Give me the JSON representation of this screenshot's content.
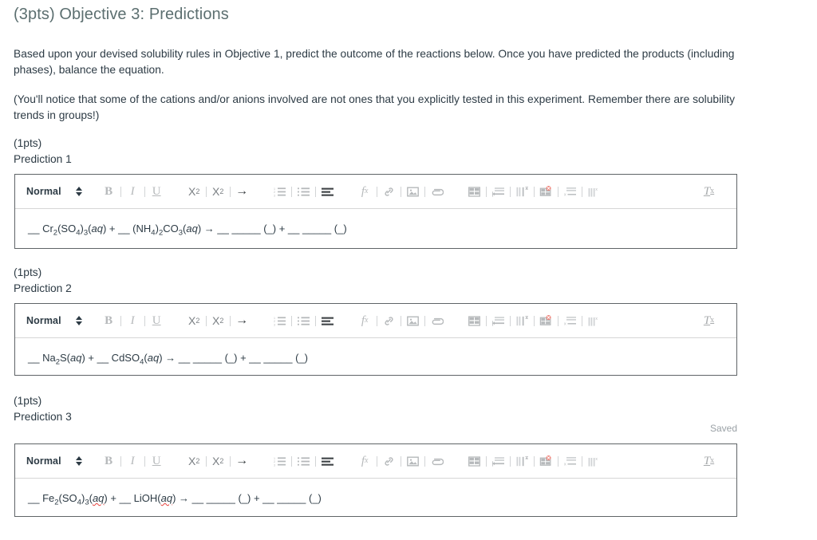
{
  "page": {
    "title": "(3pts) Objective 3: Predictions",
    "title_color": "#5c6f70",
    "paragraph_1": "Based upon your devised solubility rules in Objective 1, predict the outcome of the reactions below. Once you have predicted the products (including phases), balance the equation.",
    "paragraph_2": "(You'll notice that some of the cations and/or anions involved are not ones that you explicitly tested in this experiment. Remember there are solubility trends in groups!)",
    "saved_status": "Saved"
  },
  "toolbar": {
    "format_value": "Normal",
    "format_options": [
      "Normal"
    ],
    "bold_label": "B",
    "italic_label": "I",
    "underline_label": "U",
    "subscript_label": "X",
    "subscript_index": "2",
    "superscript_label": "X",
    "superscript_index": "2",
    "arrow_label": "→",
    "formula_label": "f",
    "formula_index": "x",
    "clear_format_label": "T",
    "clear_format_index": "x",
    "icons": [
      "numbered-list-icon",
      "bulleted-list-icon",
      "align-icon",
      "formula-icon",
      "link-icon",
      "image-icon",
      "attachment-icon",
      "table-icon",
      "table-row-icon",
      "table-column-icon",
      "table-delete-icon",
      "table-cell-icon",
      "table-merge-icon",
      "clear-formatting-icon"
    ],
    "accent_color": "#e8413c"
  },
  "predictions": [
    {
      "points": "(1pts)",
      "name": "Prediction 1",
      "equation_html": "__ Cr<sub>2</sub>(SO<sub>4</sub>)<sub>3</sub>(<i>aq</i>) + __ (NH<sub>4</sub>)<sub>2</sub>CO<sub>3</sub>(<i>aq</i>) → __ _____ (_) + __ _____ (_)",
      "equation_text": "__ Cr2(SO4)3(aq) + __ (NH4)2CO3(aq) → __ _____ (_) + __ _____ (_)"
    },
    {
      "points": "(1pts)",
      "name": "Prediction 2",
      "equation_html": "__ Na<sub>2</sub>S(<i>aq</i>) + __ CdSO<sub>4</sub>(<i>aq</i>) → __ _____ (_) + __ _____ (_)",
      "equation_text": "__ Na2S(aq) + __ CdSO4(aq) → __ _____ (_) + __ _____ (_)"
    },
    {
      "points": "(1pts)",
      "name": "Prediction 3",
      "equation_html": "__ Fe<sub>2</sub>(SO<sub>4</sub>)<sub>3</sub>(<i class=\"misspell\">aq</i>) + __ LiOH(<i class=\"misspell\">aq</i>) → __ _____ (_) + __ _____ (_)",
      "equation_text": "__ Fe2(SO4)3(aq) + __ LiOH(aq) → __ _____ (_) + __ _____ (_)"
    }
  ]
}
